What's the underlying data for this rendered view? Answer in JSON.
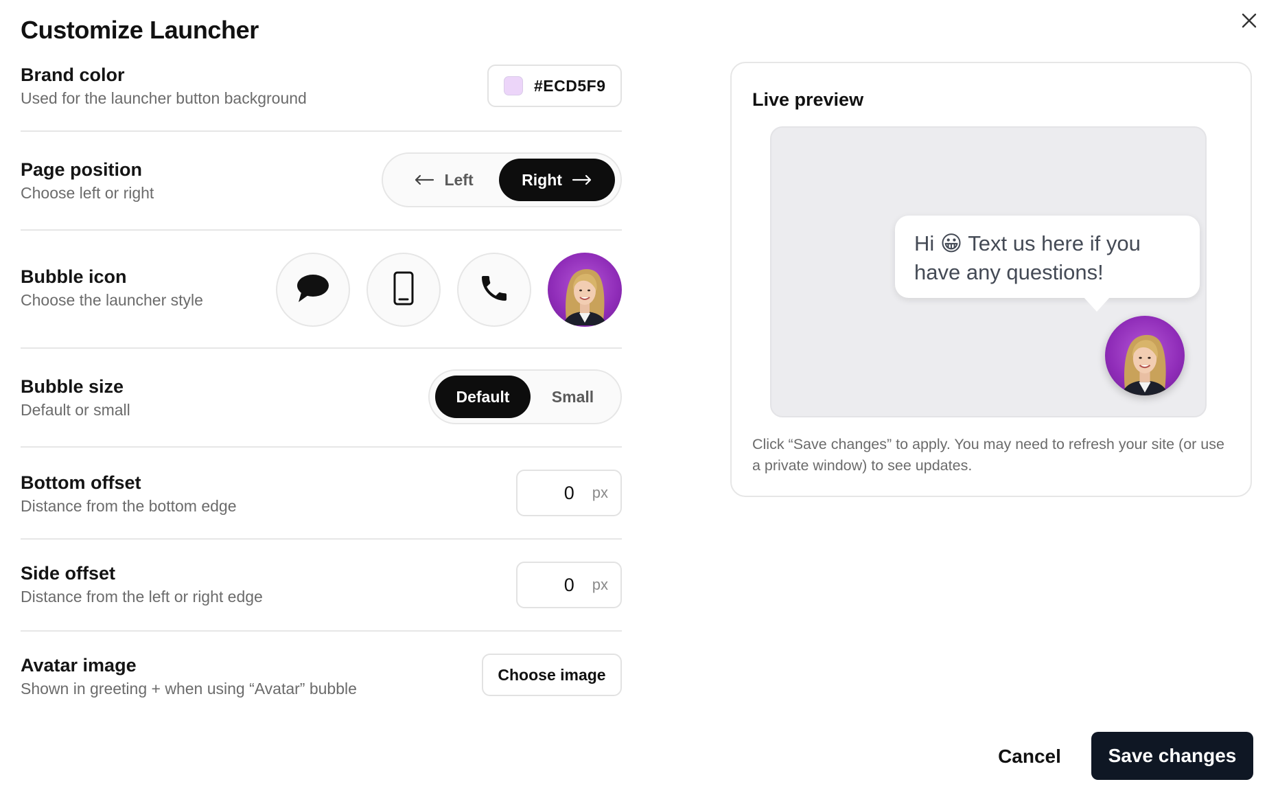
{
  "dialog": {
    "title": "Customize Launcher",
    "close_icon": "close-icon"
  },
  "settings": {
    "brand_color": {
      "label": "Brand color",
      "description": "Used for the launcher button background",
      "value": "#ECD5F9",
      "swatch_color": "#ECD5F9"
    },
    "page_position": {
      "label": "Page position",
      "description": "Choose left or right",
      "options": [
        {
          "label": "Left",
          "icon": "arrow-left-icon",
          "selected": false
        },
        {
          "label": "Right",
          "icon": "arrow-right-icon",
          "selected": true
        }
      ]
    },
    "bubble_icon": {
      "label": "Bubble icon",
      "description": "Choose the launcher style",
      "options": [
        {
          "icon": "chat-bubble-icon",
          "selected": false
        },
        {
          "icon": "mobile-phone-icon",
          "selected": false
        },
        {
          "icon": "phone-icon",
          "selected": false
        },
        {
          "icon": "avatar-photo",
          "selected": true
        }
      ]
    },
    "bubble_size": {
      "label": "Bubble size",
      "description": "Default or small",
      "options": [
        {
          "label": "Default",
          "selected": true
        },
        {
          "label": "Small",
          "selected": false
        }
      ]
    },
    "bottom_offset": {
      "label": "Bottom offset",
      "description": "Distance from the bottom edge",
      "value": "0",
      "unit": "px"
    },
    "side_offset": {
      "label": "Side offset",
      "description": "Distance from the left or right edge",
      "value": "0",
      "unit": "px"
    },
    "avatar_image": {
      "label": "Avatar image",
      "description": "Shown in greeting + when using “Avatar” bubble",
      "button_label": "Choose image"
    }
  },
  "preview": {
    "title": "Live preview",
    "greeting": "Hi 😀 Text us here if you have any questions!",
    "note": "Click “Save changes” to apply. You may need to refresh your site (or use a private window) to see updates."
  },
  "footer": {
    "cancel_label": "Cancel",
    "save_label": "Save changes"
  },
  "colors": {
    "accent_dark": "#0d0d0d",
    "save_button": "#0f1724",
    "avatar_background": "#8f2cb8"
  }
}
